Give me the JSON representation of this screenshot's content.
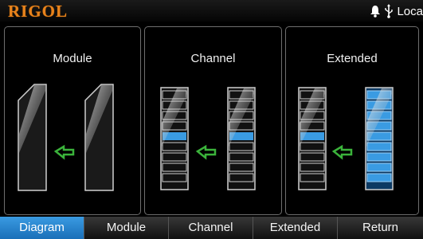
{
  "header": {
    "brand": "RIGOL",
    "status_text": "Loca",
    "status_icons": [
      "bell-icon",
      "usb-icon"
    ]
  },
  "panels": [
    {
      "title": "Module"
    },
    {
      "title": "Channel"
    },
    {
      "title": "Extended"
    }
  ],
  "menu": {
    "items": [
      {
        "label": "Diagram",
        "active": true
      },
      {
        "label": "Module",
        "active": false
      },
      {
        "label": "Channel",
        "active": false
      },
      {
        "label": "Extended",
        "active": false
      },
      {
        "label": "Return",
        "active": false
      }
    ]
  },
  "colors": {
    "brand": "#e8831c",
    "highlight_blue": "#3a9be2",
    "arrow_green": "#3bb33b"
  }
}
